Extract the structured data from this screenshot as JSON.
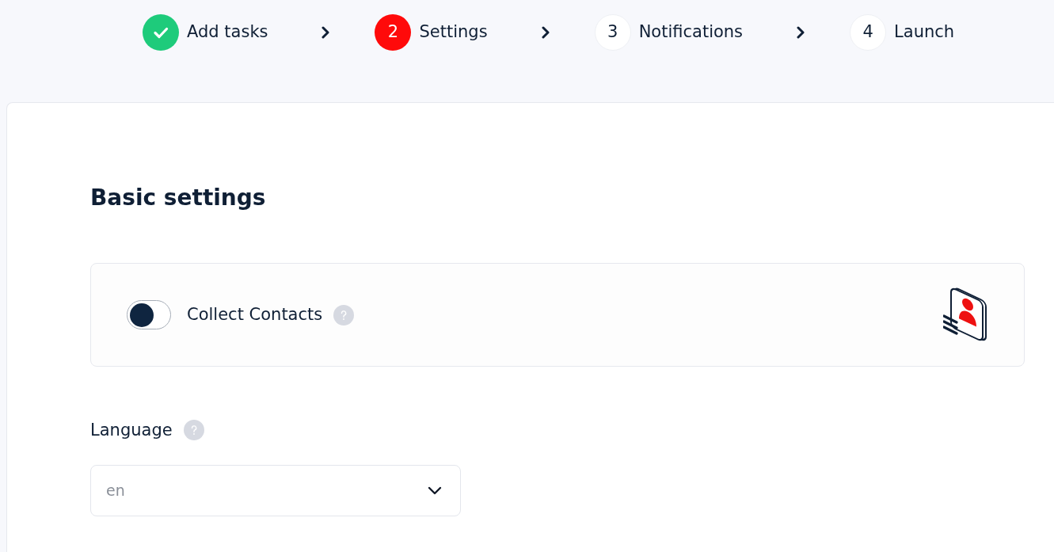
{
  "steps": [
    {
      "kind": "done",
      "label": "Add tasks"
    },
    {
      "kind": "current",
      "number": "2",
      "label": "Settings"
    },
    {
      "kind": "upcoming",
      "number": "3",
      "label": "Notifications"
    },
    {
      "kind": "upcoming",
      "number": "4",
      "label": "Launch"
    }
  ],
  "section": {
    "title": "Basic settings",
    "collect_contacts": {
      "label": "Collect Contacts",
      "on": false
    },
    "language": {
      "label": "Language",
      "value": "en"
    }
  }
}
